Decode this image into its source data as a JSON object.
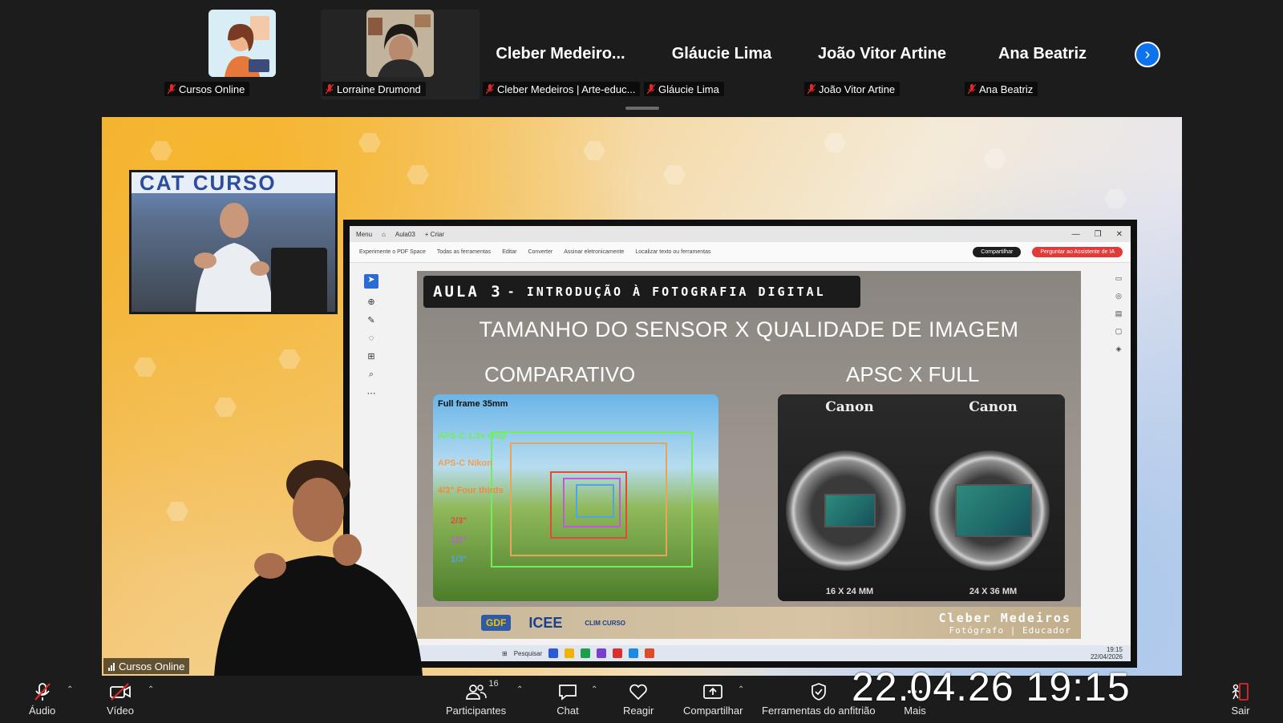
{
  "participants": [
    {
      "tag": "Cursos Online",
      "big_name": "",
      "type": "illustration"
    },
    {
      "tag": "Lorraine Drumond",
      "big_name": "",
      "type": "photo"
    },
    {
      "tag": "Cleber Medeiros | Arte-educ...",
      "big_name": "Cleber  Medeiro..."
    },
    {
      "tag": "Gláucie Lima",
      "big_name": "Gláucie Lima"
    },
    {
      "tag": "João Vitor Artine",
      "big_name": "João Vitor Artine"
    },
    {
      "tag": "Ana Beatriz",
      "big_name": "Ana Beatriz"
    }
  ],
  "share": {
    "owner_tag": "Cursos Online",
    "presenter_banner": "CAT CURSO",
    "pdf": {
      "tab_menu": "Menu",
      "tab_title": "Aula03",
      "tab_new": "+ Criar",
      "toolbar": {
        "try": "Experimente o PDF Space",
        "tools": "Todas as ferramentas",
        "edit": "Editar",
        "convert": "Converter",
        "sign": "Assinar eletronicamente",
        "search": "Localizar texto ou ferramentas",
        "share": "Compartilhar",
        "ai": "Perguntar ao Assistente de IA"
      },
      "taskbar_search": "Pesquisar",
      "taskbar_time": "19:15",
      "taskbar_date": "22/04/2026"
    },
    "slide": {
      "header_prefix": "AULA 3",
      "header_rest": "- INTRODUÇÃO À FOTOGRAFIA DIGITAL",
      "title": "TAMANHO DO SENSOR X QUALIDADE DE IMAGEM",
      "left_sub": "COMPARATIVO",
      "right_sub": "APSC X FULL",
      "sensor_labels": [
        "Full frame 35mm",
        "APS-C 1.5x crop",
        "APS-C Nikon",
        "4/3\" Four thirds",
        "2/3\"",
        "1/2\"",
        "1/3\""
      ],
      "camera_brand_left": "Canon",
      "camera_brand_right": "Canon",
      "size_left": "16 X 24 MM",
      "size_right": "24 X 36 MM",
      "footer_logos": [
        "GDF",
        "ICEE",
        "CLIM CURSO"
      ],
      "credit_name": "Cleber Medeiros",
      "credit_role": "Fotógrafo | Educador"
    }
  },
  "controls": {
    "audio": "Áudio",
    "video": "Vídeo",
    "participants": "Participantes",
    "participants_count": "16",
    "chat": "Chat",
    "react": "Reagir",
    "share": "Compartilhar",
    "host_tools": "Ferramentas do anfitrião",
    "more": "Mais",
    "leave": "Sair"
  },
  "timestamp": "22.04.26 19:15",
  "colors": {
    "accent": "#0e72ed",
    "leave": "#e02828",
    "mic_off": "#e02828"
  }
}
